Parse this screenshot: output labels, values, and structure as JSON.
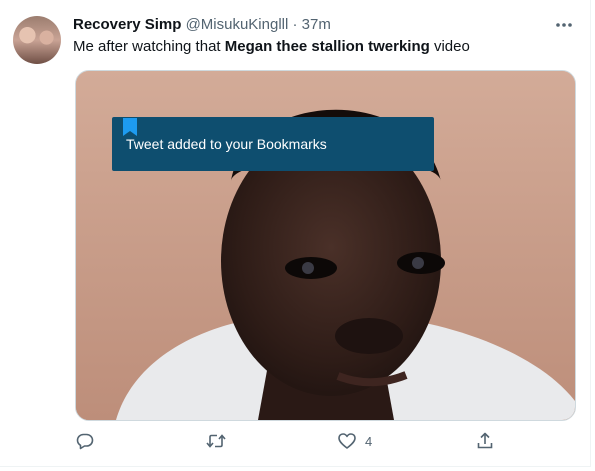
{
  "tweet": {
    "display_name": "Recovery Simp",
    "handle": "@MisukuKinglll",
    "separator": "·",
    "time": "37m",
    "text_before": "Me after watching that ",
    "text_bold": "Megan thee stallion twerking",
    "text_after": " video"
  },
  "toast": {
    "message": "Tweet added to your Bookmarks",
    "icon": "bookmark-icon"
  },
  "actions": {
    "reply_icon": "reply-icon",
    "retweet_icon": "retweet-icon",
    "like_icon": "heart-icon",
    "like_count": "4",
    "share_icon": "share-icon"
  },
  "colors": {
    "accent": "#1d9bf0",
    "toast_bg": "#0e4e6f",
    "secondary_text": "#536471"
  }
}
